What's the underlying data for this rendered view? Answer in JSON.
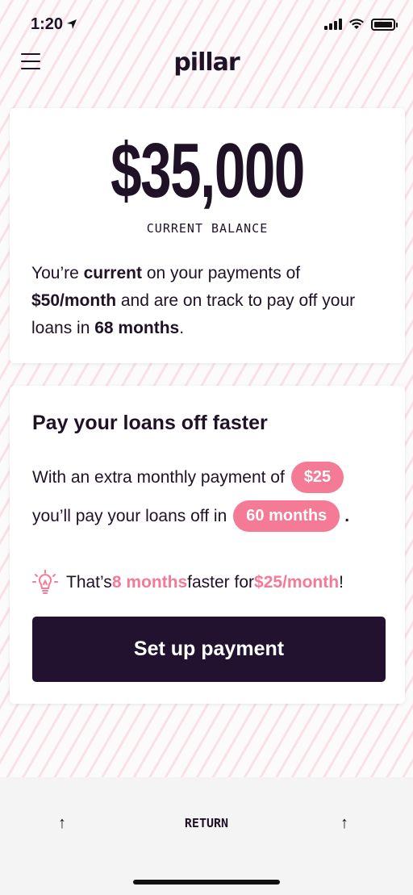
{
  "status_bar": {
    "time": "1:20"
  },
  "header": {
    "logo": "pillar"
  },
  "balance_card": {
    "amount": "$35,000",
    "label": "CURRENT BALANCE",
    "text_1": "You’re ",
    "text_2": "current",
    "text_3": " on your payments of ",
    "text_4": "$50/month",
    "text_5": " and are on track to pay off your loans in ",
    "text_6": "68 months",
    "text_7": "."
  },
  "faster_card": {
    "title": "Pay your loans off faster",
    "line1_text": "With an extra monthly payment of",
    "extra_amount": "$25",
    "line2_text": "you’ll pay your loans off in",
    "months": "60 months",
    "period": ".",
    "tip_1": "That’s ",
    "tip_2": "8 months",
    "tip_3": " faster for ",
    "tip_4": "$25/month",
    "tip_5": "!",
    "button_label": "Set up payment"
  },
  "keyboard_bar": {
    "left_arrow": "↑",
    "return_label": "RETURN",
    "right_arrow": "↑"
  },
  "colors": {
    "accent_pink": "#f47a96",
    "dark_purple": "#221230"
  }
}
